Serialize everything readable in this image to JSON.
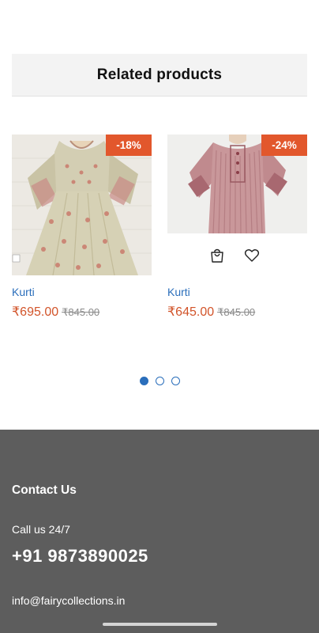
{
  "related": {
    "title": "Related products"
  },
  "products": [
    {
      "badge": "-18%",
      "name": "Kurti",
      "sale_price": "₹695.00",
      "regular_price": "₹845.00"
    },
    {
      "badge": "-24%",
      "name": "Kurti",
      "sale_price": "₹645.00",
      "regular_price": "₹845.00"
    }
  ],
  "pagination": {
    "pages": 3,
    "active": 1
  },
  "footer": {
    "heading": "Contact Us",
    "call_label": "Call us 24/7",
    "phone": "+91 9873890025",
    "email": "info@fairycollections.in"
  },
  "icons": {
    "cart": "shopping-bag-icon",
    "wishlist": "heart-icon"
  },
  "colors": {
    "accent": "#2a6ebb",
    "badge": "#e2572c",
    "sale_price": "#d2542a",
    "footer_bg": "#5d5d5d"
  }
}
